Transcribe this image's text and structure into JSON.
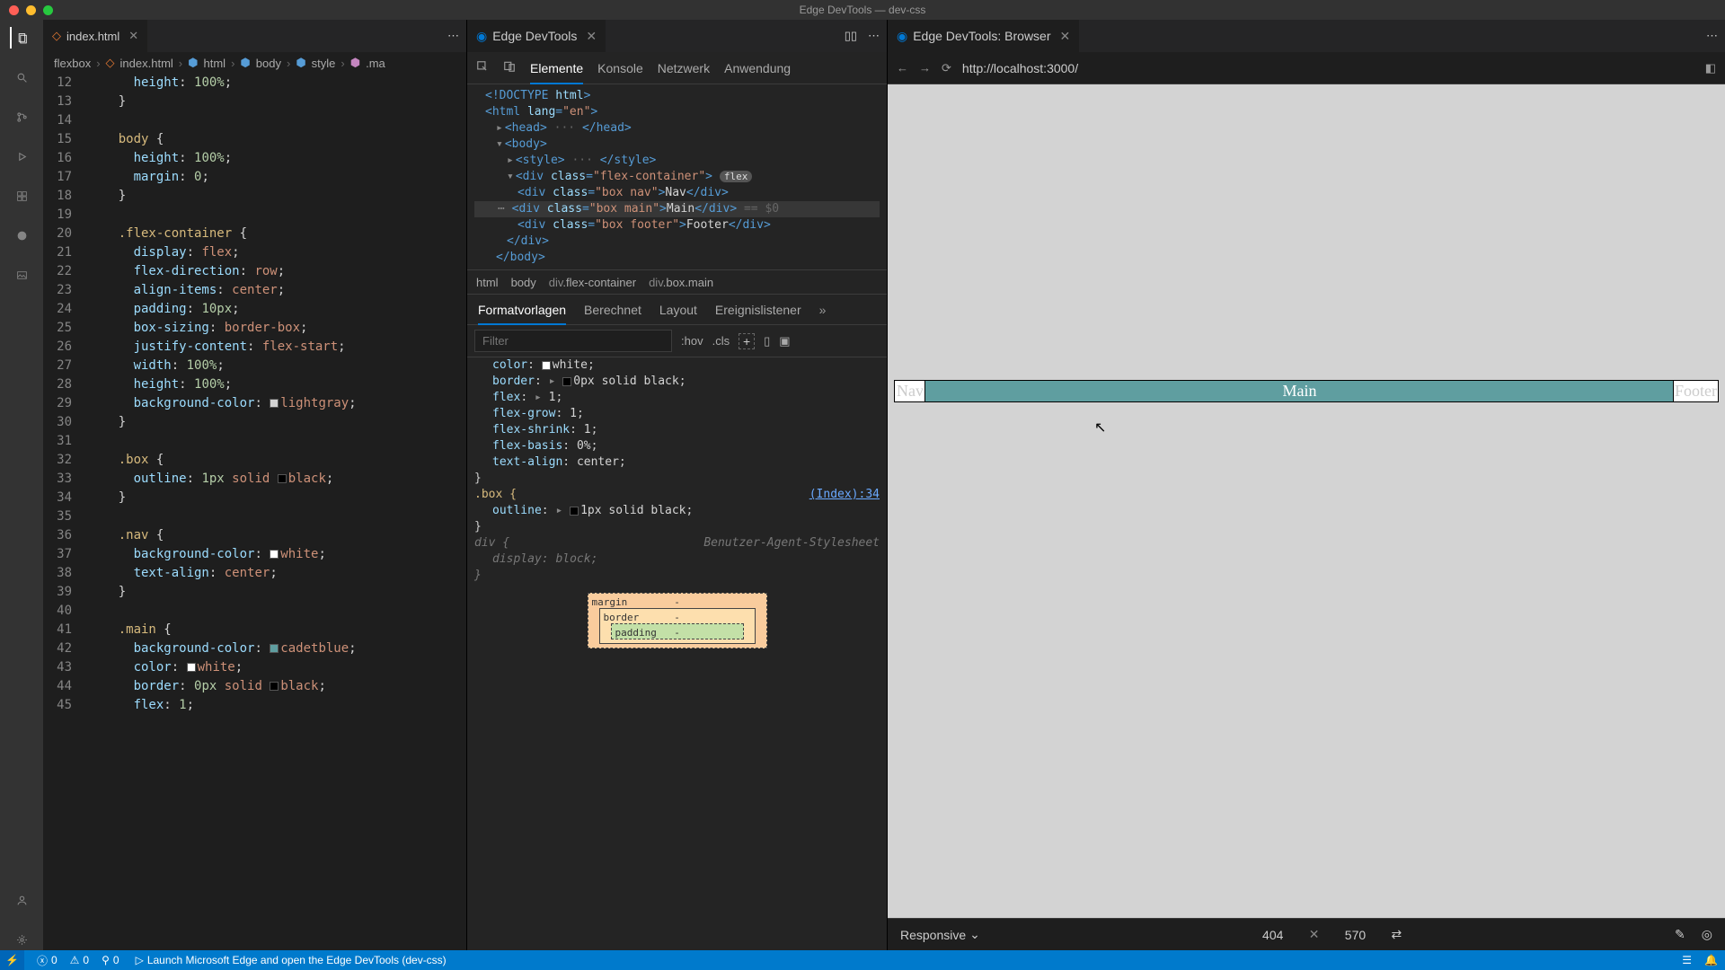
{
  "window": {
    "title": "Edge DevTools — dev-css"
  },
  "editor": {
    "tab_filename": "index.html",
    "breadcrumb": [
      "flexbox",
      "index.html",
      "html",
      "body",
      "style",
      ".ma"
    ],
    "lines": [
      {
        "n": 12,
        "i": 3,
        "t": [
          [
            "prop",
            "height"
          ],
          [
            "punc",
            ": "
          ],
          [
            "num",
            "100%"
          ],
          [
            "punc",
            ";"
          ]
        ]
      },
      {
        "n": 13,
        "i": 2,
        "t": [
          [
            "punc",
            "}"
          ]
        ]
      },
      {
        "n": 14,
        "i": 0,
        "t": []
      },
      {
        "n": 15,
        "i": 2,
        "t": [
          [
            "sel",
            "body "
          ],
          [
            "punc",
            "{"
          ]
        ]
      },
      {
        "n": 16,
        "i": 3,
        "t": [
          [
            "prop",
            "height"
          ],
          [
            "punc",
            ": "
          ],
          [
            "num",
            "100%"
          ],
          [
            "punc",
            ";"
          ]
        ]
      },
      {
        "n": 17,
        "i": 3,
        "t": [
          [
            "prop",
            "margin"
          ],
          [
            "punc",
            ": "
          ],
          [
            "num",
            "0"
          ],
          [
            "punc",
            ";"
          ]
        ]
      },
      {
        "n": 18,
        "i": 2,
        "t": [
          [
            "punc",
            "}"
          ]
        ]
      },
      {
        "n": 19,
        "i": 0,
        "t": []
      },
      {
        "n": 20,
        "i": 2,
        "t": [
          [
            "sel",
            ".flex-container "
          ],
          [
            "punc",
            "{"
          ]
        ]
      },
      {
        "n": 21,
        "i": 3,
        "t": [
          [
            "prop",
            "display"
          ],
          [
            "punc",
            ": "
          ],
          [
            "val",
            "flex"
          ],
          [
            "punc",
            ";"
          ]
        ]
      },
      {
        "n": 22,
        "i": 3,
        "t": [
          [
            "prop",
            "flex-direction"
          ],
          [
            "punc",
            ": "
          ],
          [
            "val",
            "row"
          ],
          [
            "punc",
            ";"
          ]
        ]
      },
      {
        "n": 23,
        "i": 3,
        "t": [
          [
            "prop",
            "align-items"
          ],
          [
            "punc",
            ": "
          ],
          [
            "val",
            "center"
          ],
          [
            "punc",
            ";"
          ]
        ]
      },
      {
        "n": 24,
        "i": 3,
        "t": [
          [
            "prop",
            "padding"
          ],
          [
            "punc",
            ": "
          ],
          [
            "num",
            "10px"
          ],
          [
            "punc",
            ";"
          ]
        ]
      },
      {
        "n": 25,
        "i": 3,
        "t": [
          [
            "prop",
            "box-sizing"
          ],
          [
            "punc",
            ": "
          ],
          [
            "val",
            "border-box"
          ],
          [
            "punc",
            ";"
          ]
        ]
      },
      {
        "n": 26,
        "i": 3,
        "t": [
          [
            "prop",
            "justify-content"
          ],
          [
            "punc",
            ": "
          ],
          [
            "val",
            "flex-start"
          ],
          [
            "punc",
            ";"
          ]
        ]
      },
      {
        "n": 27,
        "i": 3,
        "t": [
          [
            "prop",
            "width"
          ],
          [
            "punc",
            ": "
          ],
          [
            "num",
            "100%"
          ],
          [
            "punc",
            ";"
          ]
        ]
      },
      {
        "n": 28,
        "i": 3,
        "t": [
          [
            "prop",
            "height"
          ],
          [
            "punc",
            ": "
          ],
          [
            "num",
            "100%"
          ],
          [
            "punc",
            ";"
          ]
        ]
      },
      {
        "n": 29,
        "i": 3,
        "t": [
          [
            "prop",
            "background-color"
          ],
          [
            "punc",
            ": "
          ],
          [
            "swatch",
            "#d3d3d3"
          ],
          [
            "val",
            "lightgray"
          ],
          [
            "punc",
            ";"
          ]
        ]
      },
      {
        "n": 30,
        "i": 2,
        "t": [
          [
            "punc",
            "}"
          ]
        ]
      },
      {
        "n": 31,
        "i": 0,
        "t": []
      },
      {
        "n": 32,
        "i": 2,
        "t": [
          [
            "sel",
            ".box "
          ],
          [
            "punc",
            "{"
          ]
        ]
      },
      {
        "n": 33,
        "i": 3,
        "t": [
          [
            "prop",
            "outline"
          ],
          [
            "punc",
            ": "
          ],
          [
            "num",
            "1px "
          ],
          [
            "val",
            "solid "
          ],
          [
            "swatch",
            "#000"
          ],
          [
            "val",
            "black"
          ],
          [
            "punc",
            ";"
          ]
        ]
      },
      {
        "n": 34,
        "i": 2,
        "t": [
          [
            "punc",
            "}"
          ]
        ]
      },
      {
        "n": 35,
        "i": 0,
        "t": []
      },
      {
        "n": 36,
        "i": 2,
        "t": [
          [
            "sel",
            ".nav "
          ],
          [
            "punc",
            "{"
          ]
        ]
      },
      {
        "n": 37,
        "i": 3,
        "t": [
          [
            "prop",
            "background-color"
          ],
          [
            "punc",
            ": "
          ],
          [
            "swatch",
            "#fff"
          ],
          [
            "val",
            "white"
          ],
          [
            "punc",
            ";"
          ]
        ]
      },
      {
        "n": 38,
        "i": 3,
        "t": [
          [
            "prop",
            "text-align"
          ],
          [
            "punc",
            ": "
          ],
          [
            "val",
            "center"
          ],
          [
            "punc",
            ";"
          ]
        ]
      },
      {
        "n": 39,
        "i": 2,
        "t": [
          [
            "punc",
            "}"
          ]
        ]
      },
      {
        "n": 40,
        "i": 0,
        "t": []
      },
      {
        "n": 41,
        "i": 2,
        "t": [
          [
            "sel",
            ".main "
          ],
          [
            "punc",
            "{"
          ]
        ]
      },
      {
        "n": 42,
        "i": 3,
        "t": [
          [
            "prop",
            "background-color"
          ],
          [
            "punc",
            ": "
          ],
          [
            "swatch",
            "#5f9ea0"
          ],
          [
            "val",
            "cadetblue"
          ],
          [
            "punc",
            ";"
          ]
        ]
      },
      {
        "n": 43,
        "i": 3,
        "t": [
          [
            "prop",
            "color"
          ],
          [
            "punc",
            ": "
          ],
          [
            "swatch",
            "#fff"
          ],
          [
            "val",
            "white"
          ],
          [
            "punc",
            ";"
          ]
        ]
      },
      {
        "n": 44,
        "i": 3,
        "t": [
          [
            "prop",
            "border"
          ],
          [
            "punc",
            ": "
          ],
          [
            "num",
            "0px "
          ],
          [
            "val",
            "solid "
          ],
          [
            "swatch",
            "#000"
          ],
          [
            "val",
            "black"
          ],
          [
            "punc",
            ";"
          ]
        ]
      },
      {
        "n": 45,
        "i": 3,
        "t": [
          [
            "prop",
            "flex"
          ],
          [
            "punc",
            ": "
          ],
          [
            "num",
            "1"
          ],
          [
            "punc",
            ";"
          ]
        ]
      }
    ]
  },
  "devtools": {
    "tab_title": "Edge DevTools",
    "toolbar_tabs": [
      "Elemente",
      "Konsole",
      "Netzwerk",
      "Anwendung"
    ],
    "dom_breadcrumb": [
      "html",
      "body",
      "div.flex-container",
      "div.box.main"
    ],
    "dom": {
      "doctype": "<!DOCTYPE html>",
      "html_open": "<html lang=\"en\">",
      "head": "<head> ··· </head>",
      "body_open": "<body>",
      "style": "<style> ··· </style>",
      "fc_open": "<div class=\"flex-container\">",
      "fc_pill": "flex",
      "nav_line": "<div class=\"box nav\">Nav</div>",
      "main_line": "<div class=\"box main\">Main</div>",
      "main_hint": "== $0",
      "footer_line": "<div class=\"box footer\">Footer</div>",
      "div_close": "</div>",
      "body_close": "</body>"
    },
    "styles_tabs": [
      "Formatvorlagen",
      "Berechnet",
      "Layout",
      "Ereignislistener"
    ],
    "filter_placeholder": "Filter",
    "filter_buttons": [
      ":hov",
      ".cls"
    ],
    "styles_rules": [
      {
        "sel": "",
        "decls": [
          [
            "color",
            "white",
            "#fff"
          ],
          [
            "border",
            "0px solid black",
            "#000"
          ],
          [
            "flex",
            "1",
            ""
          ],
          [
            "flex-grow",
            "1",
            ""
          ],
          [
            "flex-shrink",
            "1",
            ""
          ],
          [
            "flex-basis",
            "0%",
            ""
          ],
          [
            "text-align",
            "center",
            ""
          ]
        ],
        "indent": true
      },
      {
        "sel": ".box {",
        "src": "(Index):34",
        "decls": [
          [
            "outline",
            "1px solid black",
            "#000"
          ]
        ]
      },
      {
        "sel": "div {",
        "src": "Benutzer-Agent-Stylesheet",
        "dim": true,
        "decls": [
          [
            "display",
            "block",
            ""
          ]
        ]
      }
    ],
    "box_model": {
      "margin": "margin",
      "border": "border",
      "padding": "padding",
      "dash": "-"
    }
  },
  "browser": {
    "tab_title": "Edge DevTools: Browser",
    "url": "http://localhost:3000/",
    "preview": {
      "nav": "Nav",
      "main": "Main",
      "footer": "Footer"
    },
    "device": {
      "mode": "Responsive",
      "w": "404",
      "h": "570"
    }
  },
  "statusbar": {
    "errors": "0",
    "warnings": "0",
    "port": "0",
    "launch": "Launch Microsoft Edge and open the Edge DevTools (dev-css)"
  }
}
